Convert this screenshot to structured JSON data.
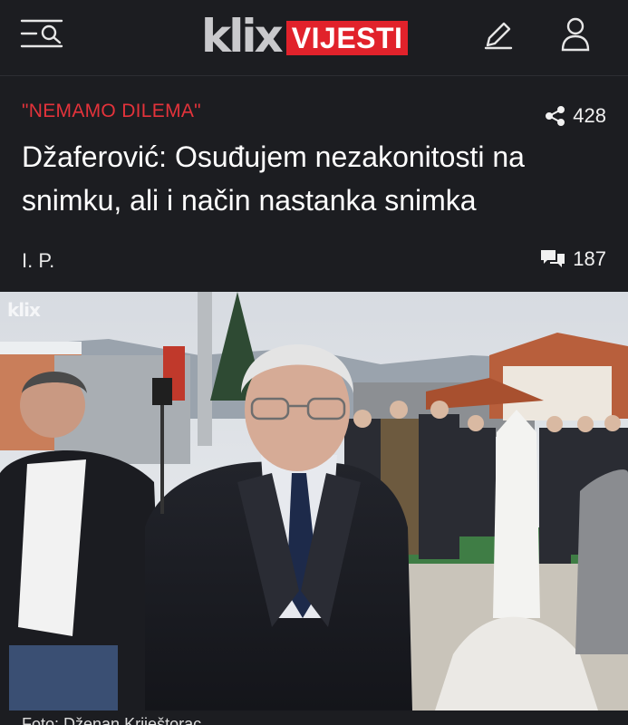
{
  "header": {
    "logo_word": "klix",
    "logo_section": "VIJESTI",
    "menu_icon": "menu-search-icon",
    "edit_icon": "pencil-icon",
    "user_icon": "user-icon",
    "accent": "#e1222b"
  },
  "article": {
    "kicker": "\"NEMAMO DILEMA\"",
    "share_count": "428",
    "title": "Džaferović: Osuđujem nezakonitosti na snimku, ali i način nastanka snimka",
    "author": "I. P.",
    "comment_count": "187",
    "photo_watermark": "klix"
  },
  "footer": {
    "text": "Foto: Dženan Kriještorac"
  }
}
